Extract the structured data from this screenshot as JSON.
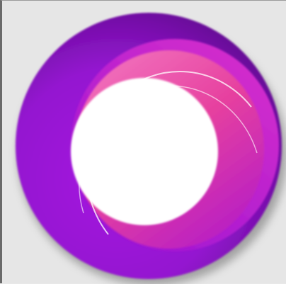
{
  "logo": {
    "icon": "ring-logo-icon",
    "colors": {
      "background": "#e6e6e6",
      "outer_purple": "#9a17d6",
      "outer_purple_dark": "#5e0f8a",
      "pink": "#ec4aa6",
      "magenta": "#c61fc8",
      "inner": "#ffffff"
    }
  }
}
